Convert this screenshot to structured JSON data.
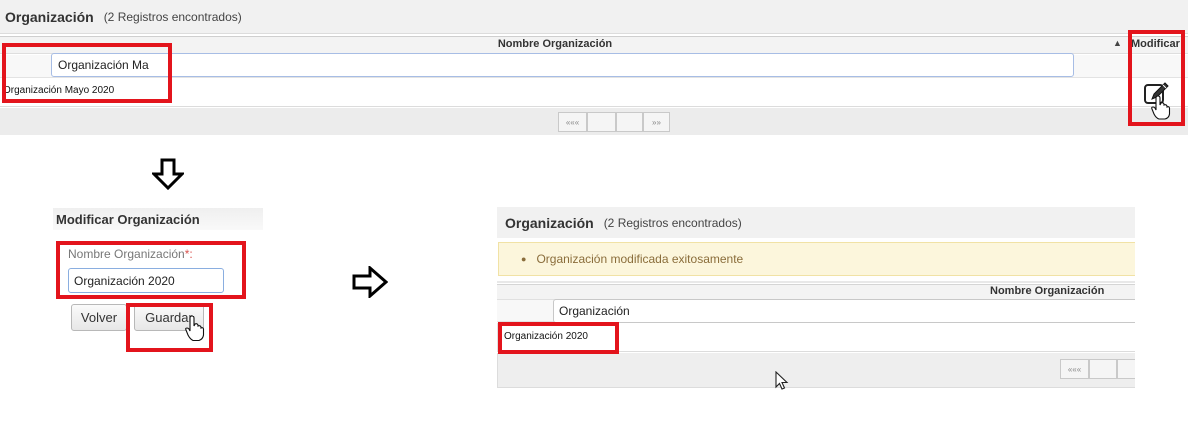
{
  "colors": {
    "highlight": "#e3141c",
    "input_border": "#a7bde5",
    "success_bg": "#fcf6dc",
    "success_text": "#8a6d3b"
  },
  "panel1": {
    "title": "Organización",
    "count": "(2 Registros encontrados)",
    "column_header": "Nombre Organización",
    "sort_icon": "sort-icon",
    "modify_header": "Modificar",
    "filter_value": "Organización Ma",
    "row_value": "Organización Mayo 2020",
    "edit_icon": "edit-icon",
    "pager": {
      "first": "«««",
      "prev": "",
      "next": "",
      "last": "»»"
    }
  },
  "panel2": {
    "title": "Modificar Organización",
    "field_label": "Nombre Organización",
    "required_mark": "*:",
    "field_value": "Organización 2020",
    "back_button": "Volver",
    "save_button": "Guardar"
  },
  "panel3": {
    "title": "Organización",
    "count": "(2 Registros encontrados)",
    "success_message": "Organización modificada exitosamente",
    "column_header": "Nombre Organización",
    "filter_value": "Organización",
    "row_value": "Organización 2020",
    "pager": {
      "first": "«««",
      "prev": ""
    }
  },
  "icons": [
    "arrow-down-icon",
    "arrow-right-icon",
    "hand-cursor-icon",
    "mouse-pointer-icon"
  ]
}
